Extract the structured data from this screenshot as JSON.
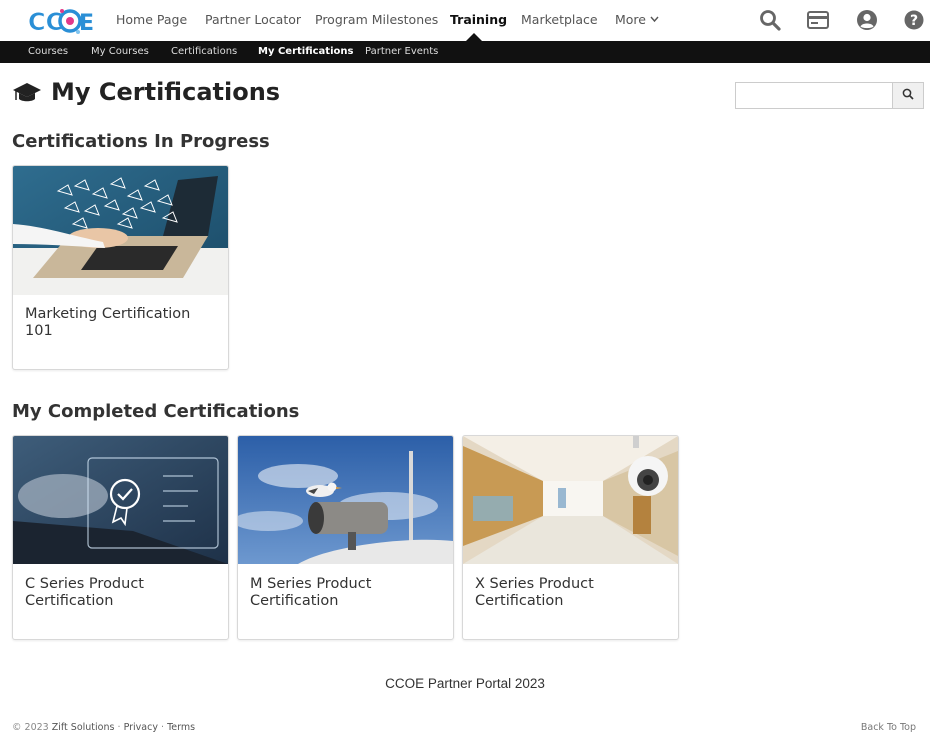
{
  "brand": {
    "logo_text": "CCOE",
    "logo_color": "#2a8fd6",
    "logo_accent": "#e23a8b"
  },
  "nav": {
    "items": [
      {
        "label": "Home Page",
        "active": false
      },
      {
        "label": "Partner Locator",
        "active": false
      },
      {
        "label": "Program Milestones",
        "active": false
      },
      {
        "label": "Training",
        "active": true
      },
      {
        "label": "Marketplace",
        "active": false
      },
      {
        "label": "More",
        "active": false
      }
    ],
    "icons": [
      "search-icon",
      "card-icon",
      "user-icon",
      "help-icon"
    ]
  },
  "subnav": {
    "items": [
      {
        "label": "Courses",
        "active": false
      },
      {
        "label": "My Courses",
        "active": false
      },
      {
        "label": "Certifications",
        "active": false
      },
      {
        "label": "My Certifications",
        "active": true
      },
      {
        "label": "Partner Events",
        "active": false
      }
    ]
  },
  "page": {
    "title": "My Certifications",
    "icon": "graduation-cap-icon"
  },
  "search": {
    "placeholder": "",
    "value": "",
    "button_icon": "search-icon"
  },
  "sections": [
    {
      "title": "Certifications In Progress",
      "cards": [
        {
          "title": "Marketing Certification 101",
          "image": "laptop-hands-image"
        }
      ]
    },
    {
      "title": "My Completed Certifications",
      "cards": [
        {
          "title": "C Series Product Certification",
          "image": "digital-certificate-image"
        },
        {
          "title": "M Series Product Certification",
          "image": "seagull-camera-image"
        },
        {
          "title": "X Series Product Certification",
          "image": "hospital-camera-image"
        }
      ]
    }
  ],
  "footer": {
    "center": "CCOE Partner Portal 2023",
    "copyright": "© 2023",
    "company": "Zift Solutions",
    "privacy": "Privacy",
    "terms": "Terms",
    "sep": "·",
    "back_to_top": "Back To Top"
  }
}
